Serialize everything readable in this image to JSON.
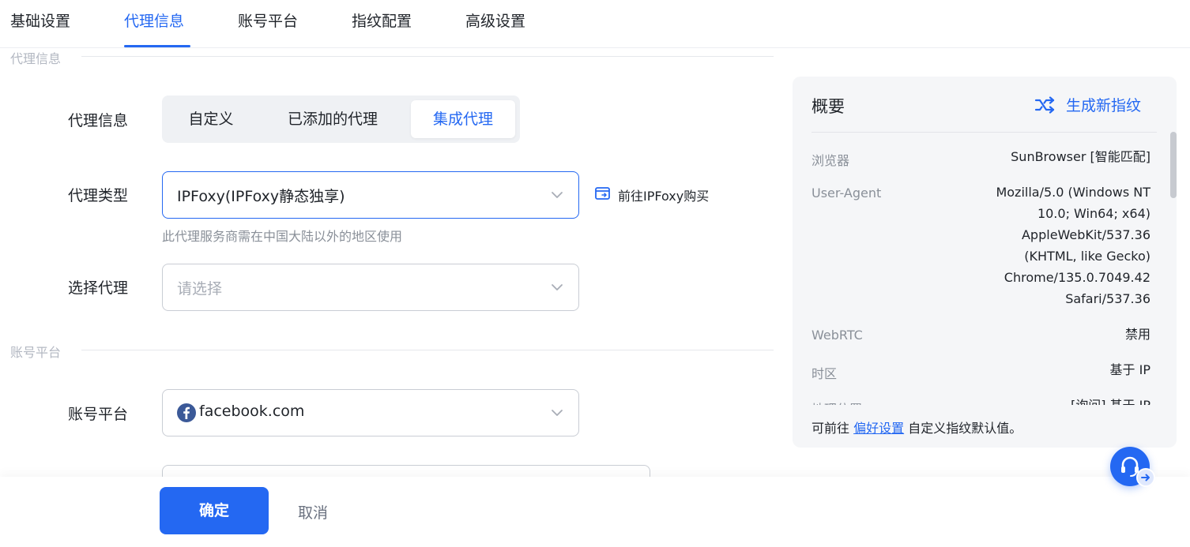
{
  "tabs": [
    {
      "label": "基础设置",
      "active": false
    },
    {
      "label": "代理信息",
      "active": true
    },
    {
      "label": "账号平台",
      "active": false
    },
    {
      "label": "指纹配置",
      "active": false
    },
    {
      "label": "高级设置",
      "active": false
    }
  ],
  "sections": {
    "proxy_title": "代理信息",
    "account_title": "账号平台"
  },
  "proxy": {
    "info_label": "代理信息",
    "modes": [
      "自定义",
      "已添加的代理",
      "集成代理"
    ],
    "selected_mode": "集成代理",
    "type_label": "代理类型",
    "type_value": "IPFoxy(IPFoxy静态独享)",
    "buy_link": "前往IPFoxy购买",
    "type_hint": "此代理服务商需在中国大陆以外的地区使用",
    "select_label": "选择代理",
    "select_placeholder": "请选择"
  },
  "account": {
    "label": "账号平台",
    "value": "facebook.com"
  },
  "summary": {
    "title": "概要",
    "generate_button": "生成新指纹",
    "rows": [
      {
        "key": "浏览器",
        "value": [
          "SunBrowser [智能匹配]"
        ]
      },
      {
        "key": "User-Agent",
        "value": [
          "Mozilla/5.0 (Windows NT",
          "10.0; Win64; x64)",
          "AppleWebKit/537.36",
          "(KHTML, like Gecko)",
          "Chrome/135.0.7049.42",
          "Safari/537.36"
        ]
      },
      {
        "key": "WebRTC",
        "value": [
          "禁用"
        ]
      },
      {
        "key": "时区",
        "value": [
          "基于 IP"
        ]
      },
      {
        "key": "地理位置",
        "value": [
          "[询问] 基于 IP"
        ]
      }
    ],
    "footer_prefix": "可前往",
    "footer_link": "偏好设置",
    "footer_suffix": "自定义指纹默认值。"
  },
  "actions": {
    "ok": "确定",
    "cancel": "取消"
  },
  "colors": {
    "accent": "#2468f2",
    "muted": "#8a9099",
    "panel_bg": "#f5f6f8"
  },
  "icons": {
    "generate": "shuffle-icon",
    "buy": "external-link-icon",
    "platform": "facebook-icon",
    "support": "headset-icon"
  }
}
